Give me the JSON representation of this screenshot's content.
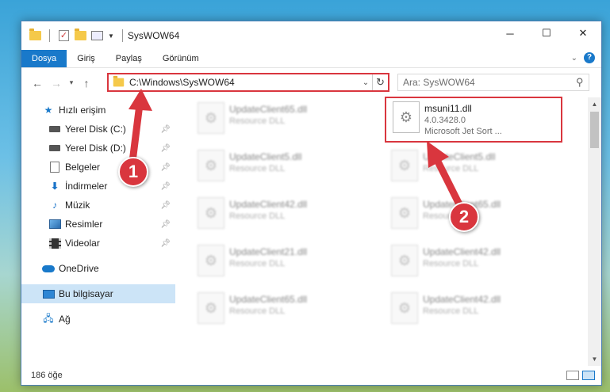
{
  "window": {
    "title": "SysWOW64",
    "controls": {
      "minimize": "─",
      "maximize": "☐",
      "close": "✕"
    }
  },
  "ribbon": {
    "tabs": [
      "Dosya",
      "Giriş",
      "Paylaş",
      "Görünüm"
    ],
    "active_tab": "Dosya"
  },
  "address_bar": {
    "path": "C:\\Windows\\SysWOW64",
    "search_placeholder": "Ara: SysWOW64"
  },
  "nav_pane": {
    "quick_access": "Hızlı erişim",
    "pinned": [
      {
        "label": "Yerel Disk (C:)",
        "icon": "drive-icon"
      },
      {
        "label": "Yerel Disk (D:)",
        "icon": "drive-icon"
      },
      {
        "label": "Belgeler",
        "icon": "documents-icon"
      },
      {
        "label": "İndirmeler",
        "icon": "downloads-icon"
      },
      {
        "label": "Müzik",
        "icon": "music-icon"
      },
      {
        "label": "Resimler",
        "icon": "pictures-icon"
      },
      {
        "label": "Videolar",
        "icon": "videos-icon"
      }
    ],
    "onedrive": "OneDrive",
    "this_pc": "Bu bilgisayar",
    "network": "Ağ",
    "selected": "Bu bilgisayar"
  },
  "files": {
    "highlighted": {
      "name": "msuni11.dll",
      "version": "4.0.3428.0",
      "description": "Microsoft Jet Sort ..."
    },
    "left_column": [
      {
        "name": "UpdateClient65.dll",
        "sub": "Resource DLL"
      },
      {
        "name": "UpdateClient5.dll",
        "sub": "Resource DLL"
      },
      {
        "name": "UpdateClient42.dll",
        "sub": "Resource DLL"
      },
      {
        "name": "UpdateClient21.dll",
        "sub": "Resource DLL"
      },
      {
        "name": "UpdateClient65.dll",
        "sub": "Resource DLL"
      }
    ],
    "right_column": [
      {
        "name": "UpdateClient5.dll",
        "sub": "Resource DLL"
      },
      {
        "name": "UpdateClient65.dll",
        "sub": "Resource DLL"
      },
      {
        "name": "UpdateClient42.dll",
        "sub": "Resource DLL"
      },
      {
        "name": "UpdateClient42.dll",
        "sub": "Resource DLL"
      }
    ]
  },
  "status_bar": {
    "item_count": "186 öğe"
  },
  "annotations": {
    "badge_1": "1",
    "badge_2": "2",
    "highlight_color": "#d9363e"
  }
}
